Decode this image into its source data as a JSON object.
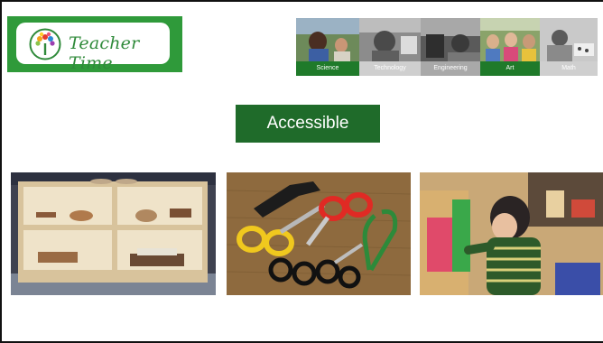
{
  "brand": {
    "name": "Teacher Time"
  },
  "steam": [
    {
      "label": "Science",
      "color": "#1f7a2a"
    },
    {
      "label": "Technology",
      "color": "#cfcfcf"
    },
    {
      "label": "Engineering",
      "color": "#a9a9a9"
    },
    {
      "label": "Art",
      "color": "#1f7a2a"
    },
    {
      "label": "Math",
      "color": "#cfcfcf"
    }
  ],
  "slide": {
    "title": "Accessible"
  },
  "photos": [
    {
      "subject": "wooden-shelf"
    },
    {
      "subject": "scissors-and-tongs"
    },
    {
      "subject": "child-at-easel"
    }
  ]
}
